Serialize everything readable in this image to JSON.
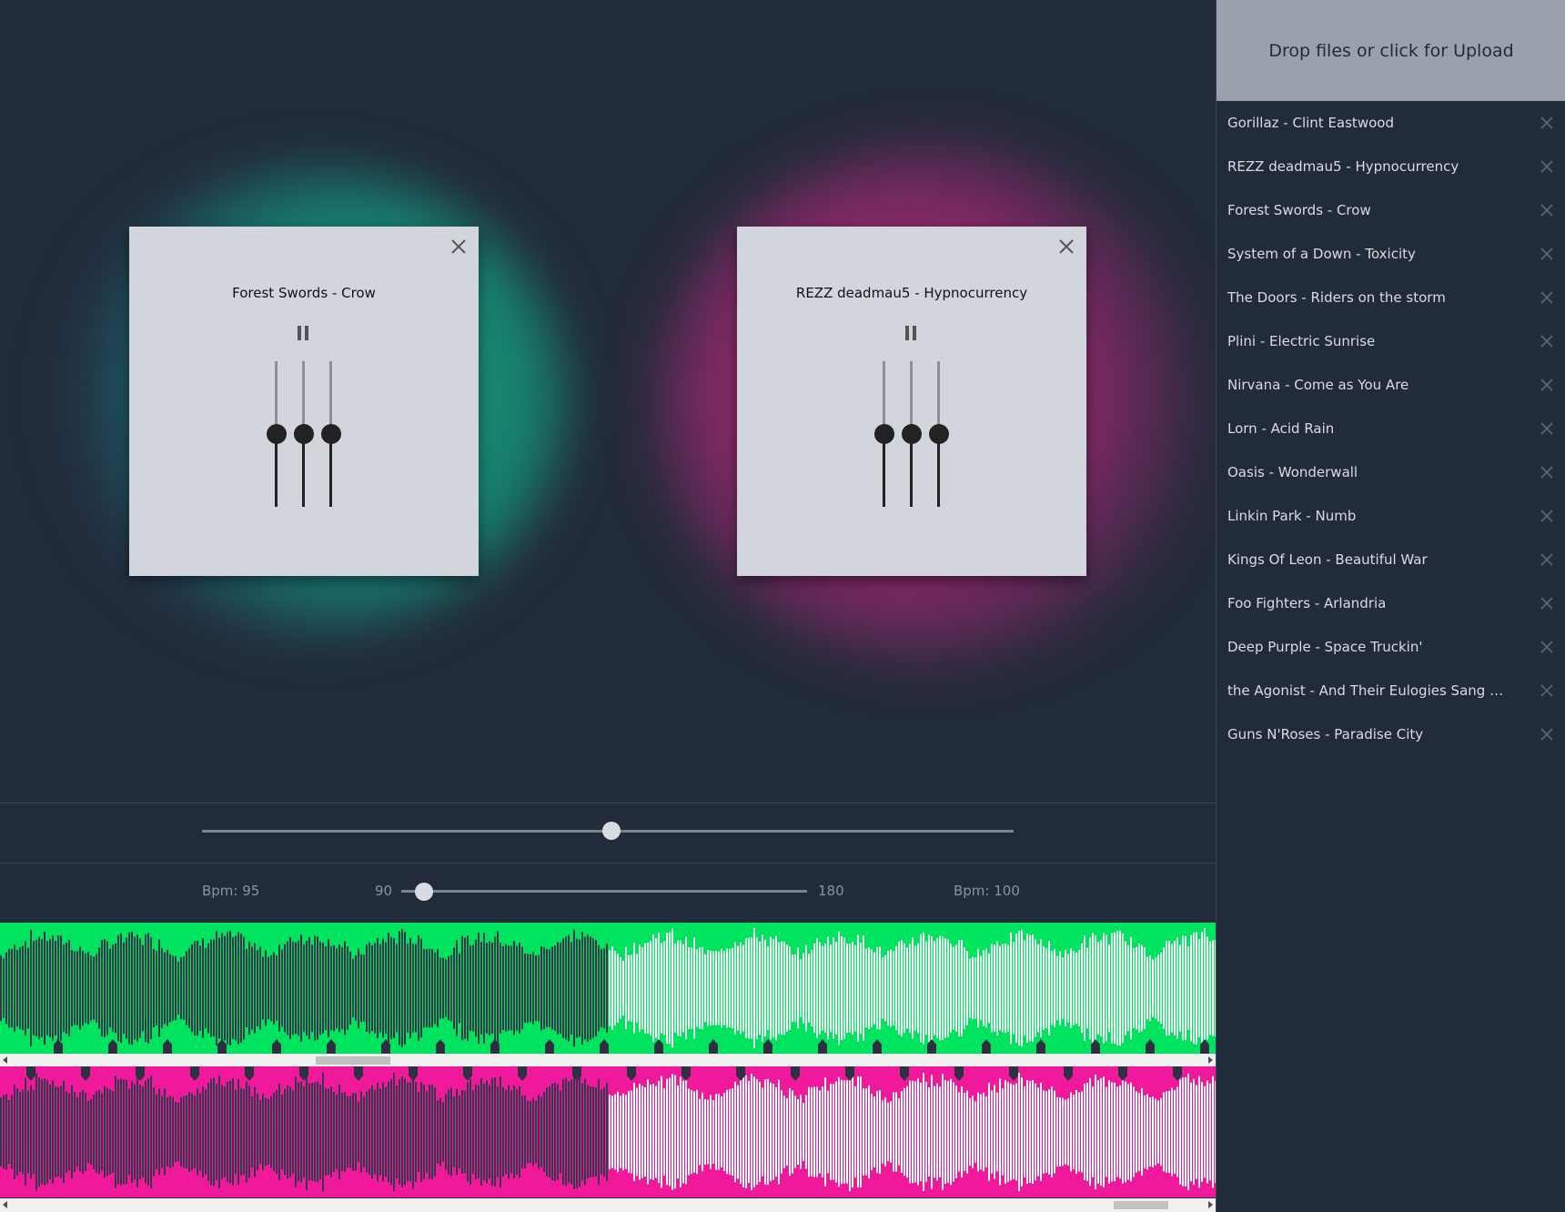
{
  "upload": {
    "label": "Drop files or click for Upload"
  },
  "tracks": [
    "Gorillaz - Clint Eastwood",
    "REZZ deadmau5 - Hypnocurrency",
    "Forest Swords - Crow",
    "System of a Down - Toxicity",
    "The Doors - Riders on the storm",
    "Plini - Electric Sunrise",
    "Nirvana - Come as You Are",
    "Lorn - Acid Rain",
    "Oasis - Wonderwall",
    "Linkin Park - Numb",
    "Kings Of Leon - Beautiful War",
    "Foo Fighters - Arlandria",
    "Deep Purple - Space Truckin'",
    "the Agonist - And Their Eulogies Sang Me...",
    "Guns N'Roses - Paradise City"
  ],
  "decks": {
    "a": {
      "title": "Forest Swords - Crow",
      "color": "#00e35f",
      "eq_levels": [
        0.5,
        0.5,
        0.5
      ]
    },
    "b": {
      "title": "REZZ deadmau5 - Hypnocurrency",
      "color": "#f0199c",
      "eq_levels": [
        0.5,
        0.5,
        0.5
      ]
    }
  },
  "crossfader": {
    "value": 0.5
  },
  "bpm": {
    "left": "Bpm: 95",
    "min": "90",
    "max": "180",
    "right": "Bpm: 100"
  },
  "tempo": {
    "value": 90
  },
  "waveforms": {
    "a": {
      "played_fraction": 0.5,
      "color": "#00e35f"
    },
    "b": {
      "played_fraction": 0.5,
      "color": "#f0199c"
    }
  },
  "icons": {
    "close": "close-icon",
    "pause": "pause-icon"
  }
}
